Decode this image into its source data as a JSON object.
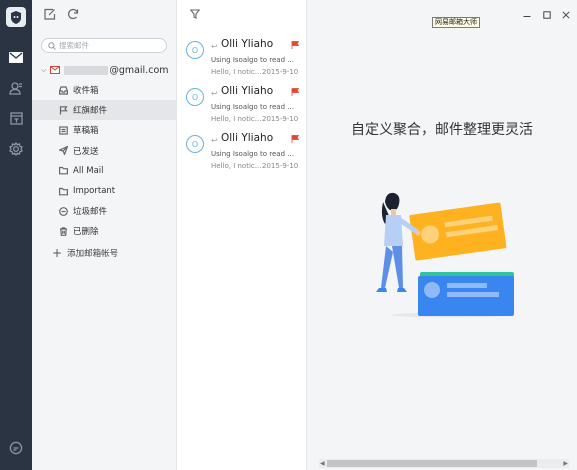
{
  "app": {
    "tooltip": "网易邮箱大师"
  },
  "rail": {
    "items": [
      {
        "icon": "logo-icon"
      },
      {
        "icon": "mail-icon",
        "active": true
      },
      {
        "icon": "contacts-icon"
      },
      {
        "icon": "calendar-icon"
      },
      {
        "icon": "settings-icon"
      },
      {
        "icon": "chat-icon"
      }
    ]
  },
  "folders": {
    "search_placeholder": "搜索邮件",
    "account_suffix": "@gmail.com",
    "items": [
      {
        "label": "收件箱",
        "icon": "inbox-icon"
      },
      {
        "label": "红旗邮件",
        "icon": "flag-icon",
        "active": true
      },
      {
        "label": "草稿箱",
        "icon": "drafts-icon"
      },
      {
        "label": "已发送",
        "icon": "sent-icon"
      },
      {
        "label": "All Mail",
        "icon": "folder-icon"
      },
      {
        "label": "Important",
        "icon": "folder-icon"
      },
      {
        "label": "垃圾邮件",
        "icon": "spam-icon"
      },
      {
        "label": "已删除",
        "icon": "trash-icon"
      }
    ],
    "add_account": "添加邮箱帐号"
  },
  "mails": [
    {
      "avatar": "O",
      "sender": "Olli Yliaho",
      "subject": "Using Isoalgo to read ...",
      "preview": "Hello, I notic...",
      "date": "2015-9-10"
    },
    {
      "avatar": "O",
      "sender": "Olli Yliaho",
      "subject": "Using Isoalgo to read ...",
      "preview": "Hello, I notic...",
      "date": "2015-9-10"
    },
    {
      "avatar": "O",
      "sender": "Olli Yliaho",
      "subject": "Using Isoalgo to read ...",
      "preview": "Hello, I notic...",
      "date": "2015-9-10"
    }
  ],
  "preview": {
    "slogan": "自定义聚合，邮件整理更灵活"
  },
  "colors": {
    "rail_bg": "#2b3442",
    "flag_red": "#e8452f",
    "avatar_blue": "#69b2e5",
    "card_orange": "#ffb21f",
    "card_blue": "#3a86f0",
    "card_green": "#2fc4a0"
  }
}
